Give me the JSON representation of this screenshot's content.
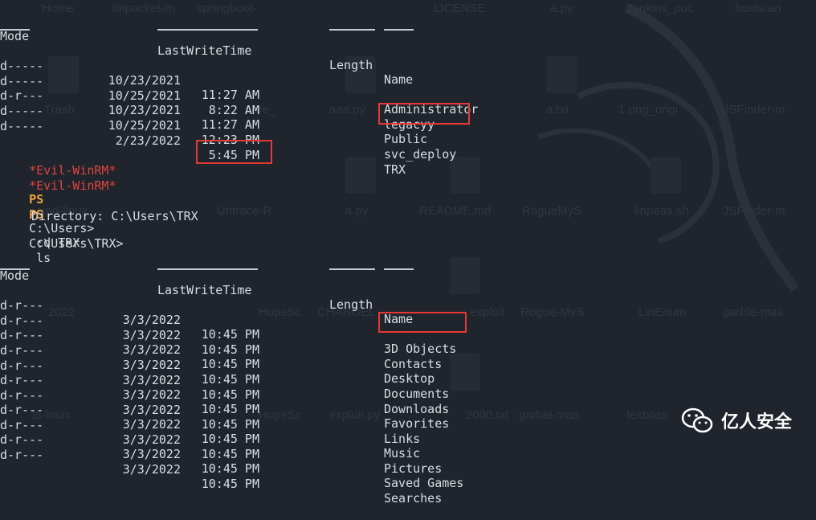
{
  "background_ghost_labels": [
    "Home",
    "impacket-m",
    "springboot-",
    "LICENSE",
    "a.py",
    "Jenkins_poc",
    "hostsran",
    "Trash",
    "Lore_",
    "aaa.py",
    "a.txt",
    "1.png_origi",
    "JSFinder-m",
    "cmd-linux",
    "Untrace-R",
    "a.py",
    "README.md",
    "RogueMyS",
    "linpeas.sh",
    "JSFinder-m",
    "2022",
    "HopeSc",
    "CHANGEL",
    "exploit",
    "Rogue-MyS",
    "LinEnum",
    "garble-mas",
    "rescan-linux",
    "ts-linux",
    "HopeSc",
    "exploit.py",
    "2000.txt",
    "garble-mas",
    "texboss"
  ],
  "listing1": {
    "headers": {
      "mode": "Mode",
      "lastwritetime": "LastWriteTime",
      "length": "Length",
      "name": "Name"
    },
    "rows": [
      {
        "mode": "d-----",
        "date": "10/23/2021",
        "time": "11:27 AM",
        "name": "Administrator"
      },
      {
        "mode": "d-----",
        "date": "10/25/2021",
        "time": "8:22 AM",
        "name": "legacyy"
      },
      {
        "mode": "d-r---",
        "date": "10/23/2021",
        "time": "11:27 AM",
        "name": "Public"
      },
      {
        "mode": "d-----",
        "date": "10/25/2021",
        "time": "12:23 PM",
        "name": "svc_deploy"
      },
      {
        "mode": "d-----",
        "date": "2/23/2022",
        "time": "5:45 PM",
        "name": "TRX"
      }
    ]
  },
  "prompts": [
    {
      "evil": "*Evil-WinRM*",
      "ps": "PS",
      "path": "C:\\Users>",
      "cmd": " cd TRX"
    },
    {
      "evil": "*Evil-WinRM*",
      "ps": "PS",
      "path": "C:\\Users\\TRX>",
      "cmd": " ls"
    }
  ],
  "directory_line": "Directory: C:\\Users\\TRX",
  "listing2": {
    "headers": {
      "mode": "Mode",
      "lastwritetime": "LastWriteTime",
      "length": "Length",
      "name": "Name"
    },
    "rows": [
      {
        "mode": "d-r---",
        "date": "3/3/2022",
        "time": "10:45 PM",
        "name": "3D Objects"
      },
      {
        "mode": "d-r---",
        "date": "3/3/2022",
        "time": "10:45 PM",
        "name": "Contacts"
      },
      {
        "mode": "d-r---",
        "date": "3/3/2022",
        "time": "10:45 PM",
        "name": "Desktop"
      },
      {
        "mode": "d-r---",
        "date": "3/3/2022",
        "time": "10:45 PM",
        "name": "Documents"
      },
      {
        "mode": "d-r---",
        "date": "3/3/2022",
        "time": "10:45 PM",
        "name": "Downloads"
      },
      {
        "mode": "d-r---",
        "date": "3/3/2022",
        "time": "10:45 PM",
        "name": "Favorites"
      },
      {
        "mode": "d-r---",
        "date": "3/3/2022",
        "time": "10:45 PM",
        "name": "Links"
      },
      {
        "mode": "d-r---",
        "date": "3/3/2022",
        "time": "10:45 PM",
        "name": "Music"
      },
      {
        "mode": "d-r---",
        "date": "3/3/2022",
        "time": "10:45 PM",
        "name": "Pictures"
      },
      {
        "mode": "d-r---",
        "date": "3/3/2022",
        "time": "10:45 PM",
        "name": "Saved Games"
      },
      {
        "mode": "d-r---",
        "date": "3/3/2022",
        "time": "10:45 PM",
        "name": "Searches"
      }
    ]
  },
  "watermark": {
    "text": "亿人安全",
    "icon": "wechat-icon"
  },
  "colors": {
    "background": "#20252d",
    "text": "#d9dde4",
    "evil_prompt": "#e0443e",
    "ps_prompt": "#f2a33a",
    "highlight_box": "#e53935"
  }
}
